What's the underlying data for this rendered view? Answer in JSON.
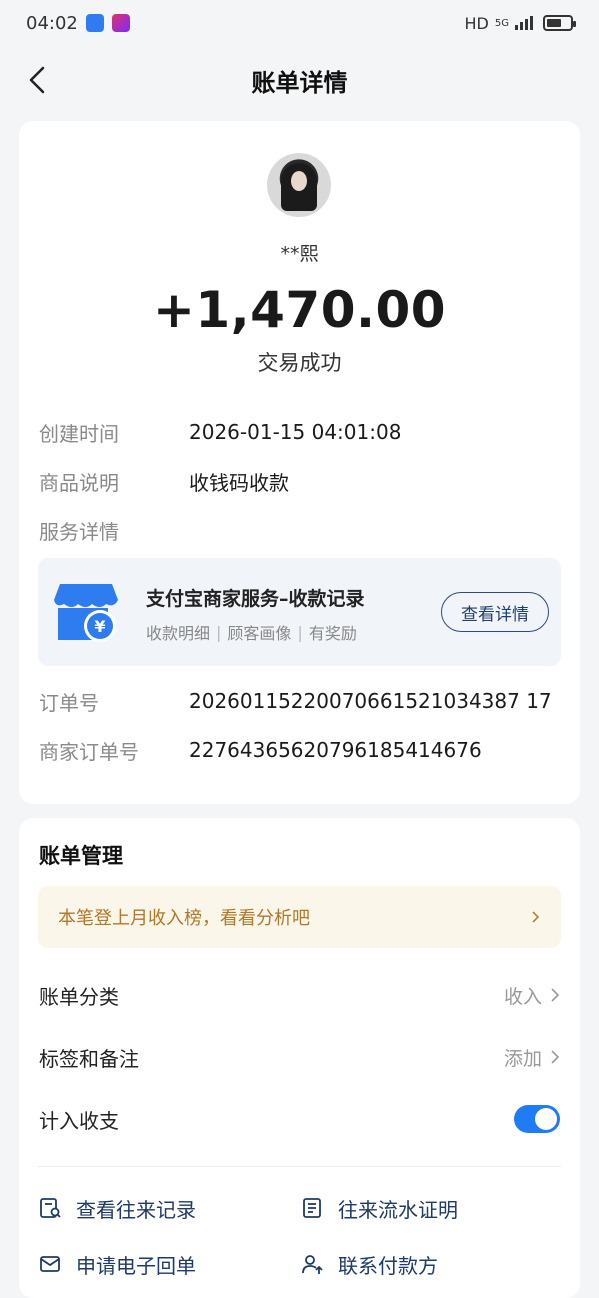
{
  "status_bar": {
    "time": "04:02",
    "network": "HD",
    "signal_label": "5G"
  },
  "nav": {
    "title": "账单详情"
  },
  "header": {
    "counterparty": "**熙",
    "amount": "+1,470.00",
    "status": "交易成功"
  },
  "details": {
    "created_label": "创建时间",
    "created_value": "2026-01-15 04:01:08",
    "product_label": "商品说明",
    "product_value": "收钱码收款",
    "service_label": "服务详情",
    "order_label": "订单号",
    "order_value": "20260115220070661521034387 17",
    "merchant_order_label": "商家订单号",
    "merchant_order_value": "22764365620796185414676"
  },
  "service_card": {
    "title": "支付宝商家服务–收款记录",
    "tags": [
      "收款明细",
      "顾客画像",
      "有奖励"
    ],
    "button": "查看详情"
  },
  "management": {
    "title": "账单管理",
    "tip": "本笔登上月收入榜，看看分析吧",
    "category_label": "账单分类",
    "category_value": "收入",
    "tag_label": "标签和备注",
    "tag_value": "添加",
    "include_label": "计入收支",
    "include_on": true
  },
  "actions": {
    "history": "查看往来记录",
    "proof": "往来流水证明",
    "receipt": "申请电子回单",
    "contact": "联系付款方"
  },
  "colors": {
    "accent": "#1f7cf2",
    "service_icon": "#2f7bf0",
    "tip_text": "#b0782a"
  }
}
